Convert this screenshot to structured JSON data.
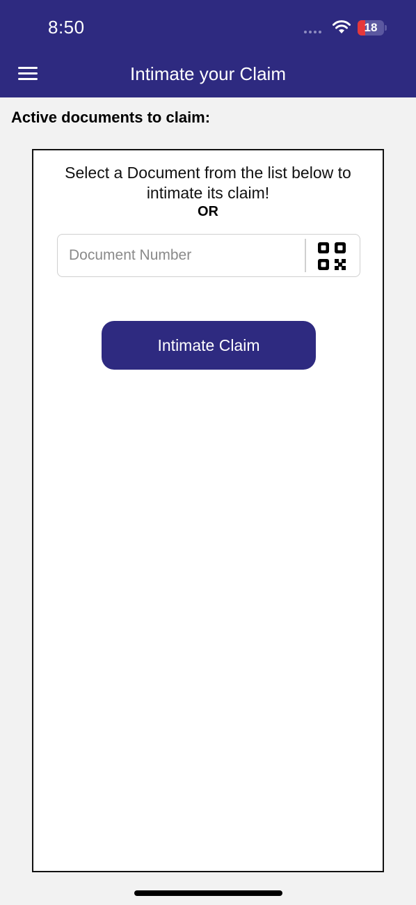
{
  "status_bar": {
    "time": "8:50",
    "battery_level": "18"
  },
  "header": {
    "title": "Intimate your Claim",
    "menu_icon": "hamburger-menu-icon"
  },
  "section": {
    "heading": "Active documents to claim:"
  },
  "card": {
    "instruction": "Select a Document from the list below to intimate its claim!",
    "or_label": "OR",
    "document_field": {
      "placeholder": "Document Number",
      "value": ""
    },
    "scan_icon": "qr-code-icon",
    "submit_label": "Intimate Claim"
  },
  "colors": {
    "brand": "#2e2a80",
    "background": "#f2f2f2",
    "battery_low": "#e5383b"
  }
}
